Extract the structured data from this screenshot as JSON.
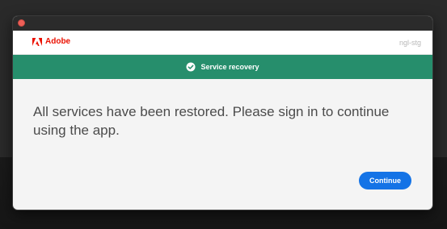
{
  "header": {
    "brand_name": "Adobe",
    "env_label": "ngl-stg"
  },
  "banner": {
    "icon": "check-circle-icon",
    "text": "Service recovery",
    "color": "#268e6c"
  },
  "main": {
    "message": "All services have been restored. Please sign in to continue using the app.",
    "continue_label": "Continue"
  },
  "colors": {
    "brand": "#eb1000",
    "accent": "#1473e6",
    "close_dot": "#ee5f57"
  }
}
